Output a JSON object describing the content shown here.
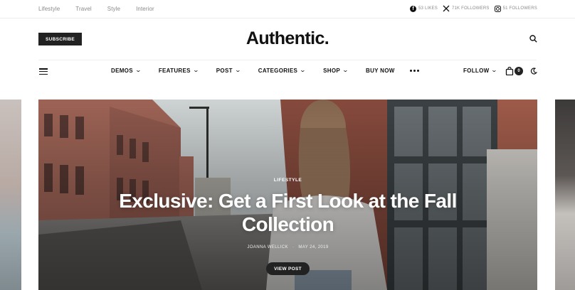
{
  "topbar": {
    "links": [
      "Lifestyle",
      "Travel",
      "Style",
      "Interior"
    ],
    "social": [
      {
        "icon": "facebook-icon",
        "label": "53 LIKES"
      },
      {
        "icon": "x-icon",
        "label": "71K FOLLOWERS"
      },
      {
        "icon": "instagram-icon",
        "label": "51 FOLLOWERS"
      }
    ]
  },
  "header": {
    "subscribe_label": "SUBSCRIBE",
    "logo": "Authentic."
  },
  "nav": {
    "items": [
      {
        "label": "DEMOS",
        "dropdown": true
      },
      {
        "label": "FEATURES",
        "dropdown": true
      },
      {
        "label": "POST",
        "dropdown": true
      },
      {
        "label": "CATEGORIES",
        "dropdown": true
      },
      {
        "label": "SHOP",
        "dropdown": true
      },
      {
        "label": "BUY NOW",
        "dropdown": false
      }
    ],
    "follow_label": "FOLLOW",
    "cart_count": "0"
  },
  "hero": {
    "category": "LIFESTYLE",
    "title": "Exclusive: Get a First Look at the Fall Collection",
    "author": "JOANNA WELLICK",
    "date": "MAY 24, 2019",
    "button_label": "VIEW POST"
  },
  "colors": {
    "accent": "#222222",
    "topbar_text": "#8a8a8a"
  }
}
